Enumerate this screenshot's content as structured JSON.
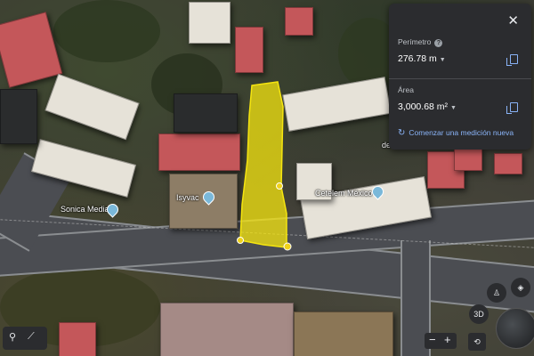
{
  "map": {
    "labels": {
      "sonica": "Sonica Media",
      "isyvac": "Isyvac",
      "cetelem": "Cetelem México",
      "partial_de": "de"
    }
  },
  "measure_panel": {
    "perimeter_label": "Perímetro",
    "perimeter_value": "276.78 m",
    "area_label": "Área",
    "area_value": "3,000.68 m²",
    "start_new": "Comenzar una medición nueva",
    "icons": [
      "close-icon",
      "help-icon",
      "copy-icon",
      "copy-icon",
      "ruler-icon"
    ]
  },
  "controls": {
    "view_3d": "3D",
    "zoom_out": "−",
    "zoom_in": "+"
  },
  "colors": {
    "panel_bg": "#2b2c2f",
    "accent": "#8ab4f8",
    "measure_fill": "#f5e50f",
    "measure_vertex": "#f0d21a"
  }
}
